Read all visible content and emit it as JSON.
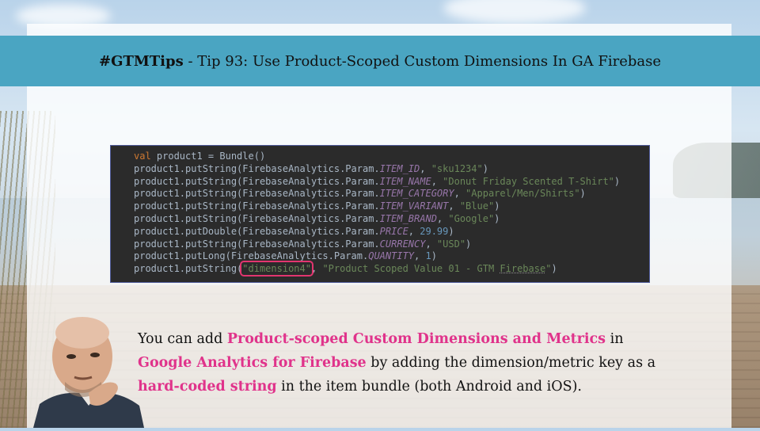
{
  "banner": {
    "brand": "#GTMTips",
    "title": " - Tip 93: Use Product-Scoped Custom Dimensions In GA Firebase"
  },
  "code": {
    "lines": [
      {
        "kw": "val",
        "rest": " product1 = Bundle()"
      },
      {
        "pre": "product1.putString(FirebaseAnalytics.Param.",
        "const": "ITEM_ID",
        "sep": ", ",
        "str": "\"sku1234\"",
        "post": ")"
      },
      {
        "pre": "product1.putString(FirebaseAnalytics.Param.",
        "const": "ITEM_NAME",
        "sep": ", ",
        "str": "\"Donut Friday Scented T-Shirt\"",
        "post": ")"
      },
      {
        "pre": "product1.putString(FirebaseAnalytics.Param.",
        "const": "ITEM_CATEGORY",
        "sep": ", ",
        "str": "\"Apparel/Men/Shirts\"",
        "post": ")"
      },
      {
        "pre": "product1.putString(FirebaseAnalytics.Param.",
        "const": "ITEM_VARIANT",
        "sep": ", ",
        "str": "\"Blue\"",
        "post": ")"
      },
      {
        "pre": "product1.putString(FirebaseAnalytics.Param.",
        "const": "ITEM_BRAND",
        "sep": ", ",
        "str": "\"Google\"",
        "post": ")"
      },
      {
        "pre": "product1.putDouble(FirebaseAnalytics.Param.",
        "const": "PRICE",
        "sep": ", ",
        "num": "29.99",
        "post": ")"
      },
      {
        "pre": "product1.putString(FirebaseAnalytics.Param.",
        "const": "CURRENCY",
        "sep": ", ",
        "str": "\"USD\"",
        "post": ")"
      },
      {
        "pre": "product1.putLong(FirebaseAnalytics.Param.",
        "const": "QUANTITY",
        "sep": ", ",
        "num": "1",
        "post": ")"
      },
      {
        "pre": "product1.putString(",
        "key": "\"dimension4\"",
        "sep": ", ",
        "str_a": "\"Product Scoped Value 01 - GTM ",
        "str_u": "Firebase",
        "str_b": "\"",
        "post": ")"
      }
    ]
  },
  "body_text": {
    "p1": "You can add ",
    "h1": "Product-scoped Custom Dimensions and Metrics",
    "p2": " in ",
    "h2": "Google Analytics for Firebase",
    "p3": " by adding the dimension/metric key as a ",
    "h3": "hard-coded string",
    "p4": " in the item bundle (both Android and iOS)."
  },
  "colors": {
    "banner": "#4aa5c2",
    "highlight": "#e0338b",
    "code_bg": "#2b2b2b"
  },
  "icons": {
    "avatar": "thinking-man-avatar"
  }
}
